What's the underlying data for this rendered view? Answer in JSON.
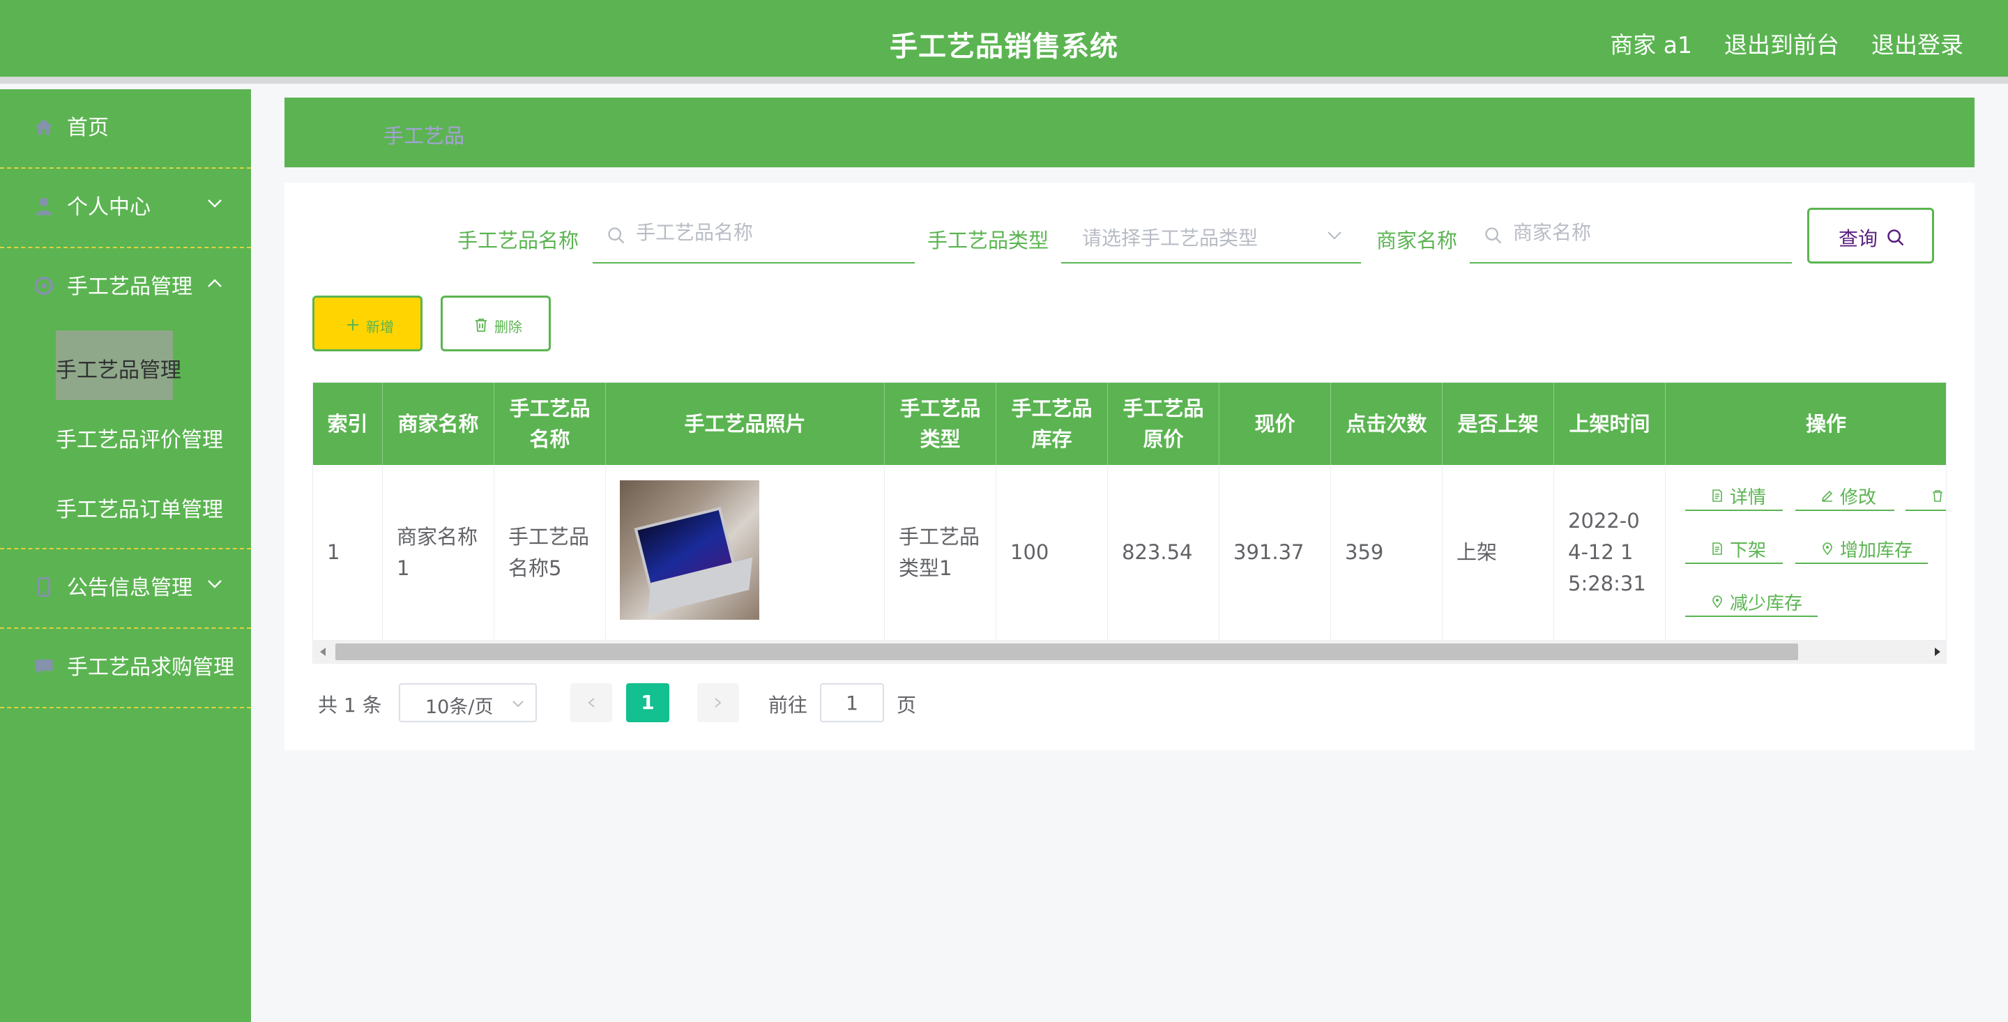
{
  "header": {
    "title": "手工艺品销售系统",
    "links": [
      "商家 a1",
      "退出到前台",
      "退出登录"
    ]
  },
  "sidebar": {
    "items": [
      {
        "label": "首页",
        "icon": "home-icon"
      },
      {
        "label": "个人中心",
        "icon": "user-icon",
        "expanded": false
      },
      {
        "label": "手工艺品管理",
        "icon": "gear-icon",
        "expanded": true,
        "children": [
          "手工艺品管理",
          "手工艺品评价管理",
          "手工艺品订单管理"
        ],
        "active_child": 0
      },
      {
        "label": "公告信息管理",
        "icon": "phone-icon",
        "expanded": false
      },
      {
        "label": "手工艺品求购管理",
        "icon": "chat-icon"
      }
    ]
  },
  "breadcrumb": "手工艺品",
  "search": {
    "name_label": "手工艺品名称",
    "name_placeholder": "手工艺品名称",
    "type_label": "手工艺品类型",
    "type_placeholder": "请选择手工艺品类型",
    "merchant_label": "商家名称",
    "merchant_placeholder": "商家名称",
    "query_label": "查询"
  },
  "actions": {
    "add_label": "新增",
    "delete_label": "删除"
  },
  "table": {
    "headers": [
      "索引",
      "商家名称",
      "手工艺品名称",
      "手工艺品照片",
      "手工艺品类型",
      "手工艺品库存",
      "手工艺品原价",
      "现价",
      "点击次数",
      "是否上架",
      "上架时间",
      "操作"
    ],
    "rows": [
      {
        "index": "1",
        "merchant": "商家名称1",
        "name": "手工艺品名称5",
        "type": "手工艺品类型1",
        "stock": "100",
        "original_price": "823.54",
        "price": "391.37",
        "clicks": "359",
        "on_shelf": "上架",
        "time": "2022-04-12 15:28:31",
        "ops": [
          "详情",
          "修改",
          "下架",
          "增加库存",
          "减少库存"
        ]
      }
    ]
  },
  "pagination": {
    "total": "共 1 条",
    "page_size": "10条/页",
    "current": "1",
    "goto_label": "前往",
    "goto_value": "1",
    "goto_suffix": "页"
  },
  "colors": {
    "primary": "#5bb451",
    "add_button": "#ffd400",
    "query_text": "#5a2080",
    "page_active": "#13c08f",
    "sidebar_divider": "#e0d23c"
  }
}
